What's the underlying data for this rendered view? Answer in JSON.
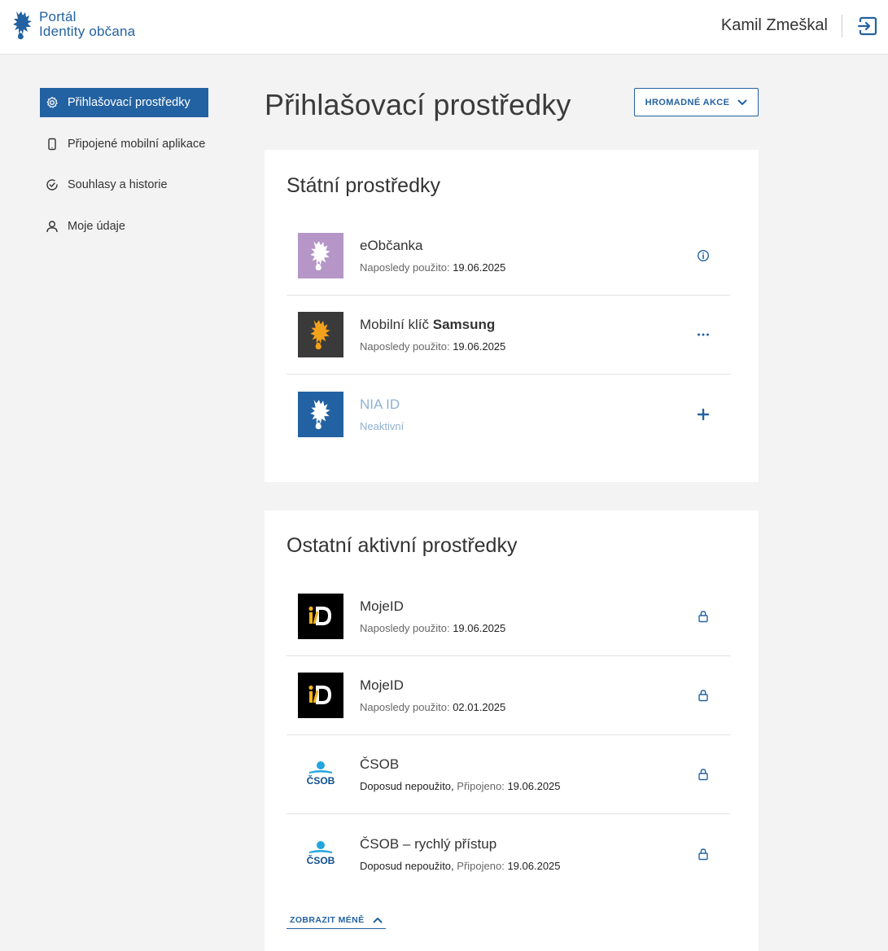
{
  "header": {
    "brand_line1": "Portál",
    "brand_line2": "Identity občana",
    "user_name": "Kamil Zmeškal"
  },
  "sidebar": {
    "items": [
      {
        "label": "Přihlašovací prostředky",
        "icon": "gear-icon",
        "active": true
      },
      {
        "label": "Připojené mobilní aplikace",
        "icon": "phone-icon",
        "active": false
      },
      {
        "label": "Souhlasy a historie",
        "icon": "check-circle-icon",
        "active": false
      },
      {
        "label": "Moje údaje",
        "icon": "user-icon",
        "active": false
      }
    ]
  },
  "main": {
    "title": "Přihlašovací prostředky",
    "bulk_actions": "HROMADNÉ AKCE",
    "state_section": {
      "title": "Státní prostředky",
      "items": [
        {
          "name": "eObčanka",
          "meta_label": "Naposledy použito:",
          "meta_value": "19.06.2025",
          "action": "info-icon"
        },
        {
          "name_prefix": "Mobilní klíč",
          "name_bold": "Samsung",
          "meta_label": "Naposledy použito:",
          "meta_value": "19.06.2025",
          "action": "more-icon"
        },
        {
          "name": "NIA ID",
          "meta_label": "Neaktivní",
          "action": "plus-icon"
        }
      ]
    },
    "other_section": {
      "title": "Ostatní aktivní prostředky",
      "items": [
        {
          "name": "MojeID",
          "logo_text": "iD",
          "meta_label": "Naposledy použito:",
          "meta_value": "19.06.2025",
          "action": "lock-icon"
        },
        {
          "name": "MojeID",
          "logo_text": "iD",
          "meta_label": "Naposledy použito:",
          "meta_value": "02.01.2025",
          "action": "lock-icon"
        },
        {
          "name": "ČSOB",
          "logo_text": "ČSOB",
          "meta_dark": "Doposud nepoužito,",
          "meta_label": "Připojeno:",
          "meta_value": "19.06.2025",
          "action": "lock-icon"
        },
        {
          "name": "ČSOB – rychlý přístup",
          "logo_text": "ČSOB",
          "meta_dark": "Doposud nepoužito,",
          "meta_label": "Připojeno:",
          "meta_value": "19.06.2025",
          "action": "lock-icon"
        }
      ]
    },
    "show_less": "ZOBRAZIT MÉNĚ"
  },
  "colors": {
    "primary": "#2362a2",
    "eobcanka_bg": "#b596c7",
    "samsung_bg": "#3a3a3a",
    "samsung_lion": "#f3a21c",
    "nia_bg": "#2362a2",
    "mojeid_bg": "#000000",
    "mojeid_accent": "#f6b21a",
    "csob_blue": "#0c4f8f",
    "csob_light": "#23a5de"
  }
}
